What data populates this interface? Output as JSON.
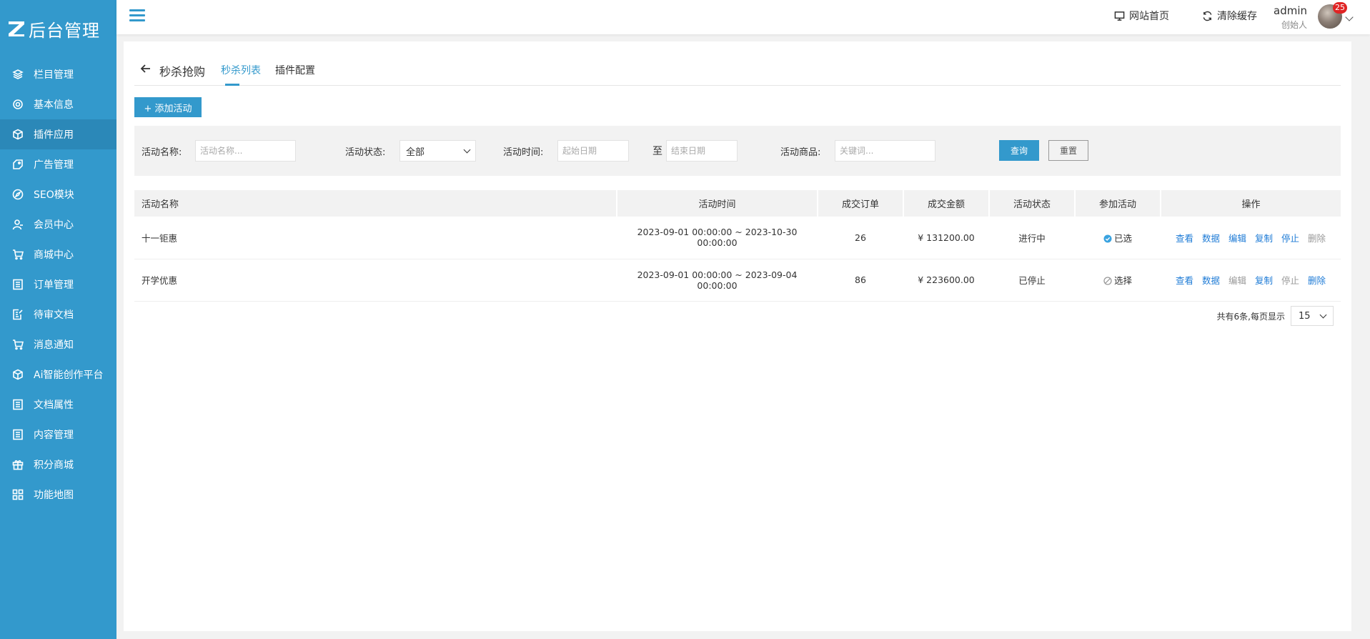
{
  "logo": {
    "text": "后台管理"
  },
  "sidebar": {
    "items": [
      {
        "label": "栏目管理",
        "icon": "layers-icon"
      },
      {
        "label": "基本信息",
        "icon": "gear-icon"
      },
      {
        "label": "插件应用",
        "icon": "cube-icon",
        "active": true
      },
      {
        "label": "广告管理",
        "icon": "tag-icon"
      },
      {
        "label": "SEO模块",
        "icon": "compass-icon"
      },
      {
        "label": "会员中心",
        "icon": "user-icon"
      },
      {
        "label": "商城中心",
        "icon": "cart-icon"
      },
      {
        "label": "订单管理",
        "icon": "list-icon"
      },
      {
        "label": "待审文档",
        "icon": "edit-doc-icon"
      },
      {
        "label": "消息通知",
        "icon": "cart-icon"
      },
      {
        "label": "Ai智能创作平台",
        "icon": "cube-icon"
      },
      {
        "label": "文档属性",
        "icon": "list-icon"
      },
      {
        "label": "内容管理",
        "icon": "list-icon"
      },
      {
        "label": "积分商城",
        "icon": "gift-icon"
      },
      {
        "label": "功能地图",
        "icon": "grid-icon"
      }
    ]
  },
  "header": {
    "site_home": "网站首页",
    "clear_cache": "清除缓存",
    "user_name": "admin",
    "user_role": "创始人",
    "badge_count": "25"
  },
  "tabs": {
    "title": "秒杀抢购",
    "list": "秒杀列表",
    "config": "插件配置"
  },
  "add_button": "+ 添加活动",
  "filter": {
    "name_label": "活动名称:",
    "name_placeholder": "活动名称...",
    "status_label": "活动状态:",
    "status_value": "全部",
    "time_label": "活动时间:",
    "start_placeholder": "起始日期",
    "to": "至",
    "end_placeholder": "结束日期",
    "goods_label": "活动商品:",
    "goods_placeholder": "关键词...",
    "query": "查询",
    "reset": "重置"
  },
  "table": {
    "headers": [
      "活动名称",
      "活动时间",
      "成交订单",
      "成交金额",
      "活动状态",
      "参加活动",
      "操作"
    ],
    "rows": [
      {
        "name": "十一钜惠",
        "time": "2023-09-01 00:00:00 ~ 2023-10-30 00:00:00",
        "orders": "26",
        "amount": "¥ 131200.00",
        "status": "进行中",
        "join": "已选"
      },
      {
        "name": "开学优惠",
        "time": "2023-09-01 00:00:00 ~ 2023-09-04 00:00:00",
        "orders": "86",
        "amount": "¥ 223600.00",
        "status": "已停止",
        "join": "选择"
      }
    ],
    "ops": [
      "查看",
      "数据",
      "编辑",
      "复制",
      "停止",
      "删除"
    ]
  },
  "pager": {
    "summary": "共有6条,每页显示",
    "page_size": "15"
  }
}
